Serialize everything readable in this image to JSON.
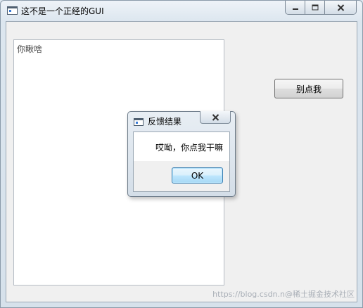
{
  "window": {
    "title": "这不是一个正经的GUI",
    "icon": "app-window-icon",
    "controls": [
      "minimize-icon",
      "maximize-icon",
      "close-icon"
    ]
  },
  "main": {
    "textarea_text": "你瞅啥",
    "button_label": "别点我"
  },
  "dialog": {
    "title": "反馈结果",
    "message": "哎呦，你点我干嘛",
    "ok_label": "OK",
    "accent": "#3c7fb1"
  },
  "watermark": "https://blog.csdn.n@稀土掘金技术社区"
}
